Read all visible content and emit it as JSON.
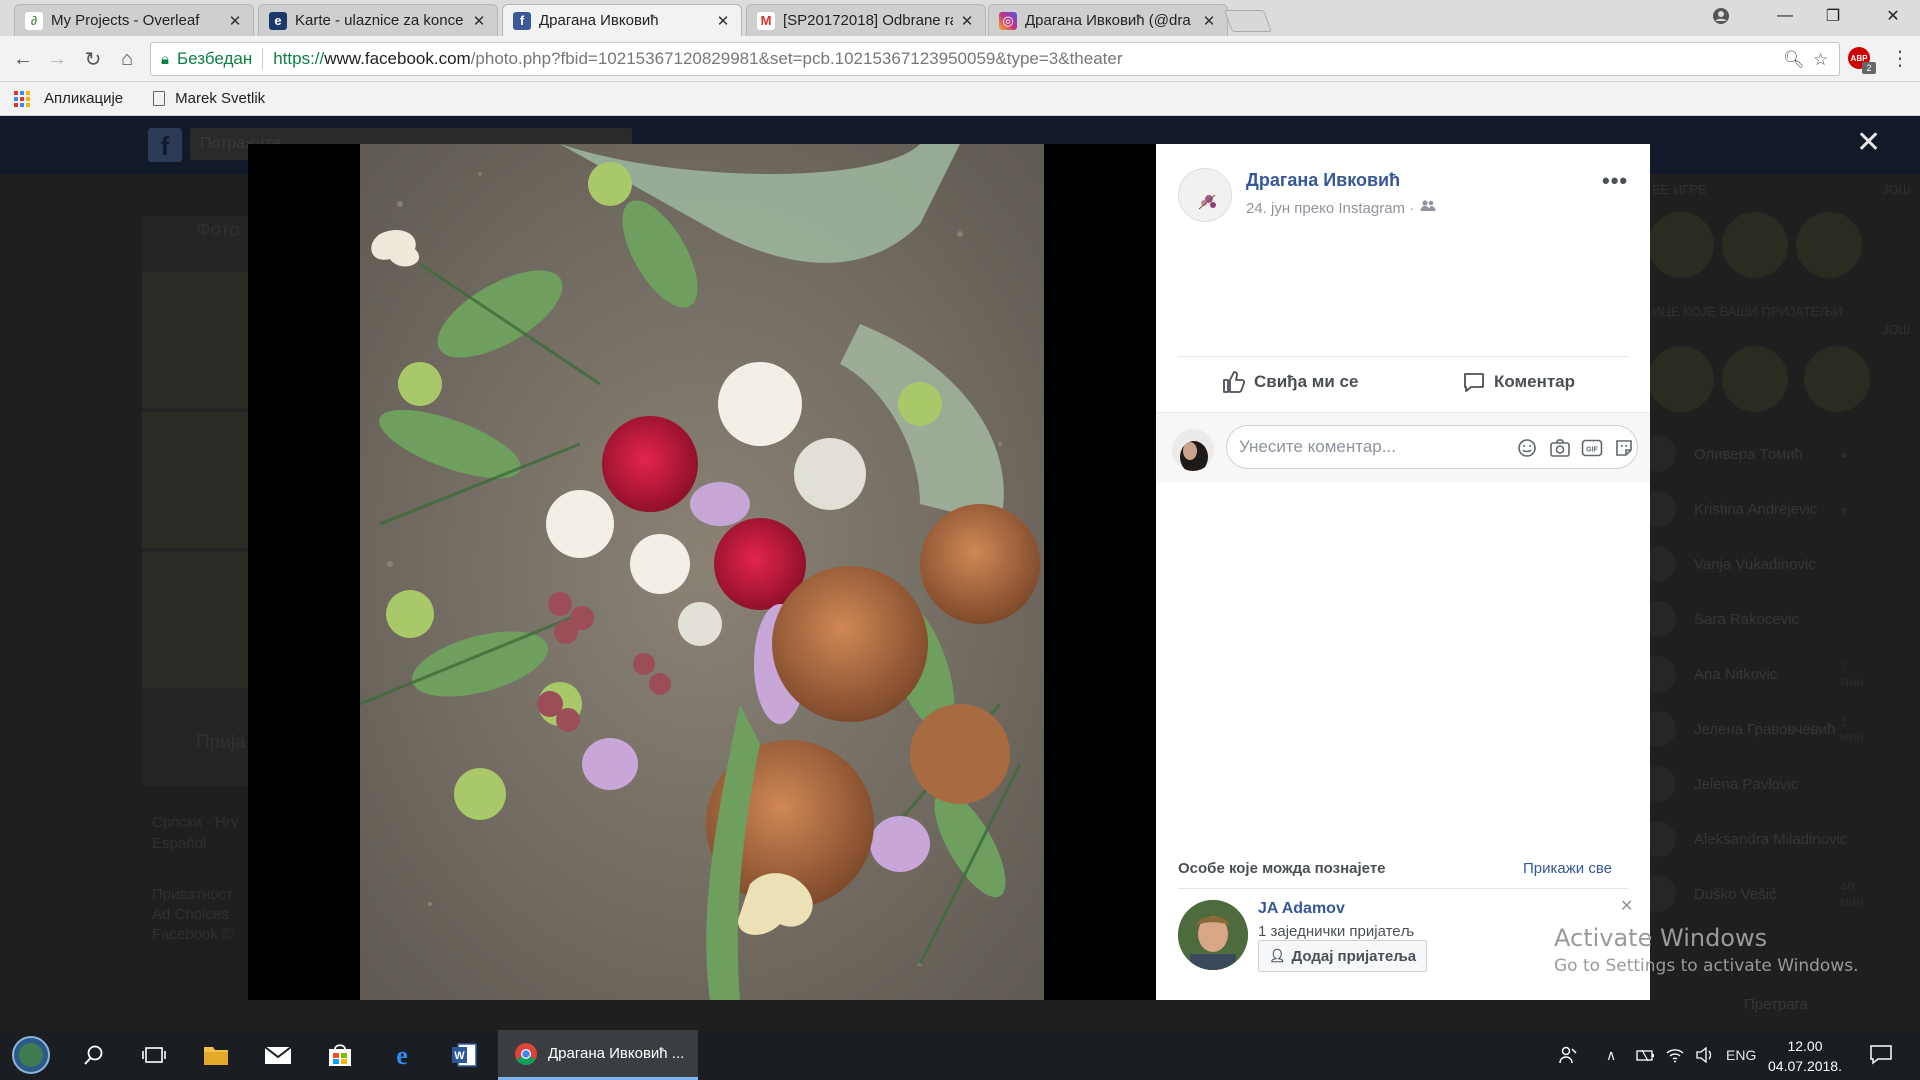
{
  "browser": {
    "tabs": [
      {
        "title": "My Projects - Overleaf",
        "icon": "overleaf-icon",
        "color": "#4f9c45"
      },
      {
        "title": "Karte - ulaznice za konce",
        "icon": "eventim-icon",
        "color": "#1b3a6a"
      },
      {
        "title": "Драгана Ивковић",
        "icon": "facebook-icon",
        "color": "#3b5998"
      },
      {
        "title": "[SP20172018] Odbrane ra",
        "icon": "gmail-icon",
        "color": "#d93025"
      },
      {
        "title": "Драгана Ивковић (@dra",
        "icon": "instagram-icon",
        "color": "#c13584"
      }
    ],
    "active_tab": 2,
    "security_label": "Безбедан",
    "url": {
      "protocol": "https://",
      "host": "www.facebook.com",
      "path": "/photo.php?fbid=10215367120829981&set=pcb.10215367123950059&type=3&theater"
    },
    "adblock_badge": "ABP",
    "adblock_count": "2",
    "bookmarks": [
      {
        "label": "Апликације",
        "icon": "apps-grid-icon"
      },
      {
        "label": "Marek Svetlik",
        "icon": "page-icon"
      }
    ]
  },
  "background": {
    "search_placeholder": "Потражите",
    "left_section_title": "Фото",
    "left_section2_title": "Прија",
    "languages": "Српски · Hrv",
    "language2": "Español",
    "footer_lines": [
      "Приватност",
      "Ad Choices",
      "Facebook ©"
    ],
    "sidebar_heading_games": "ЕЕ ИГРЕ",
    "sidebar_heading_games_right": "ЈОШ",
    "sidebar_heading_friends": "ИЦЕ КОЈЕ ВАШИ ПРИЈАТЕЉИ",
    "sidebar_heading_friends_right": "ЈОШ",
    "contacts": [
      {
        "name": "Оливера Томић",
        "time": "●"
      },
      {
        "name": "Kristina Andrejevic",
        "time": "●"
      },
      {
        "name": "Vanja Vukadinovic",
        "time": ""
      },
      {
        "name": "Sara Rakocevic",
        "time": ""
      },
      {
        "name": "Ana Nitkovic",
        "time": "7 мин"
      },
      {
        "name": "Јелена Гравовчевић",
        "time": "1 мин"
      },
      {
        "name": "Jelena Pavlovic",
        "time": ""
      },
      {
        "name": "Aleksandra Miladinovic",
        "time": ""
      },
      {
        "name": "Duško Vešić",
        "time": "40 мин"
      },
      {
        "name": "Претрага",
        "time": ""
      }
    ]
  },
  "post": {
    "author": "Драгана Ивковић",
    "meta": "24. јун преко Instagram ·",
    "audience_icon": "friends-icon",
    "like_label": "Свиђа ми се",
    "comment_label": "Коментар",
    "comment_placeholder": "Унесите коментар...",
    "comment_icons": [
      "emoji-icon",
      "camera-icon",
      "gif-icon",
      "sticker-icon"
    ]
  },
  "pymk": {
    "title": "Особе које можда познајете",
    "see_all": "Прикажи све",
    "person": {
      "name": "JA Adamov",
      "mutual": "1 заједнички пријатељ",
      "add_label": "Додај пријатеља"
    }
  },
  "watermark": {
    "line1": "Activate Windows",
    "line2": "Go to Settings to activate Windows."
  },
  "taskbar": {
    "chrome_label": "Драгана Ивковић ...",
    "language": "ENG",
    "time": "12.00",
    "date": "04.07.2018."
  }
}
